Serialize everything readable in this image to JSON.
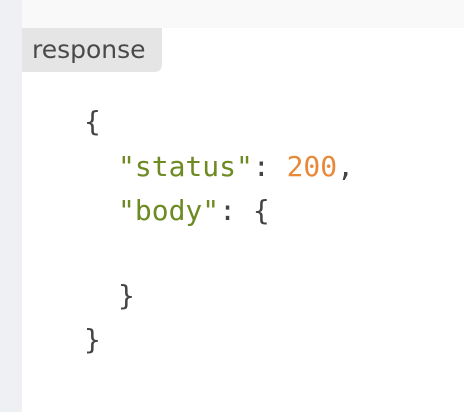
{
  "label": "response",
  "json": {
    "open_brace": "{",
    "status_key": "\"status\"",
    "colon": ":",
    "status_value": "200",
    "comma": ",",
    "body_key": "\"body\"",
    "body_open": "{",
    "body_close": "}",
    "close_brace": "}"
  },
  "colors": {
    "string": "#6e8a23",
    "number": "#e8893a",
    "punctuation": "#444444"
  }
}
